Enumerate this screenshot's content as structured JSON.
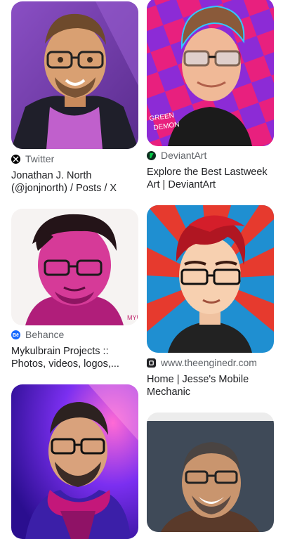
{
  "results": [
    {
      "column": "left",
      "source": {
        "name": "Twitter",
        "icon": "x-logo-icon",
        "icon_color": "#000000"
      },
      "title_lines": [
        "Jonathan J. North",
        "(@jonjnorth) / Posts / X"
      ],
      "image": "cartoon-portrait-man-glasses-pink-turtleneck"
    },
    {
      "column": "left",
      "source": {
        "name": "Behance",
        "icon": "behance-logo-icon",
        "icon_color": "#1769ff"
      },
      "title_lines": [
        "Mykulbrain Projects ::",
        "Photos, videos, logos,..."
      ],
      "image": "magenta-portrait-man-glasses"
    },
    {
      "column": "left",
      "source": null,
      "title_lines": [],
      "image": "cartoon-man-glasses-purple-scarf"
    },
    {
      "column": "right",
      "source": {
        "name": "DeviantArt",
        "icon": "deviantart-logo-icon",
        "icon_color": "#05cc47"
      },
      "title_lines": [
        "Explore the Best Lastweek",
        "Art | DeviantArt"
      ],
      "image": "cartoon-man-glasses-checkered-background",
      "image_text": "GREEN DEMON"
    },
    {
      "column": "right",
      "source": {
        "name": "www.theenginedr.com",
        "icon": "globe-site-icon",
        "icon_color": "#202124"
      },
      "title_lines": [
        "Home | Jesse's Mobile",
        "Mechanic"
      ],
      "image": "cartoon-man-red-hair-glasses-sunburst"
    },
    {
      "column": "right",
      "source": null,
      "title_lines": [],
      "image": "smiling-man-glasses-photo-cartoon"
    }
  ]
}
